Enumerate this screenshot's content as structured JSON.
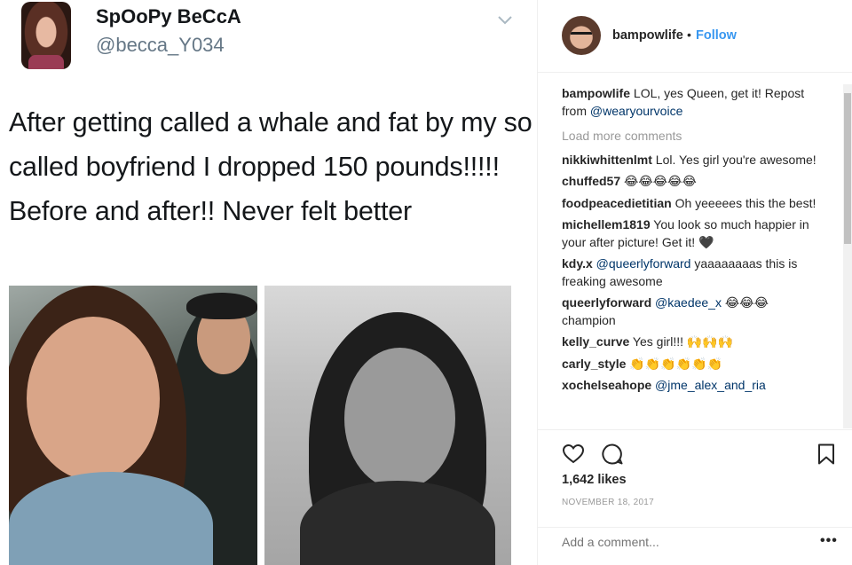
{
  "tweet": {
    "name": "SpOoPy BeCcA",
    "handle": "@becca_Y034",
    "text": "After getting called a whale and fat by my so called boyfriend I dropped 150 pounds!!!!! Before and after!! Never felt better"
  },
  "instagram": {
    "username": "bampowlife",
    "separator": "•",
    "follow_label": "Follow",
    "caption": {
      "user": "bampowlife",
      "text": " LOL, yes Queen, get it! Repost from ",
      "mention": "@wearyourvoice"
    },
    "load_more": "Load more comments",
    "comments": [
      {
        "user": "nikkiwhittenlmt",
        "pre": " Lol. Yes girl you're awesome!",
        "mention": "",
        "post": ""
      },
      {
        "user": "chuffed57",
        "pre": " 😂😂😂😂😂",
        "mention": "",
        "post": ""
      },
      {
        "user": "foodpeacedietitian",
        "pre": " Oh yeeeees this the best!",
        "mention": "",
        "post": ""
      },
      {
        "user": "michellem1819",
        "pre": " You look so much happier in your after picture! Get it! 🖤",
        "mention": "",
        "post": ""
      },
      {
        "user": "kdy.x",
        "pre": " ",
        "mention": "@queerlyforward",
        "post": " yaaaaaaaas this is freaking awesome"
      },
      {
        "user": "queerlyforward",
        "pre": " ",
        "mention": "@kaedee_x",
        "post": " 😂😂😂 champion"
      },
      {
        "user": "kelly_curve",
        "pre": " Yes girl!!! 🙌🙌🙌",
        "mention": "",
        "post": ""
      },
      {
        "user": "carly_style",
        "pre": " 👏👏👏👏👏👏",
        "mention": "",
        "post": ""
      },
      {
        "user": "xochelseahope",
        "pre": " ",
        "mention": "@jme_alex_and_ria",
        "post": ""
      }
    ],
    "likes": "1,642 likes",
    "date": "NOVEMBER 18, 2017",
    "add_comment_placeholder": "Add a comment...",
    "more_label": "•••"
  },
  "colors": {
    "link": "#3897f0",
    "mention": "#003569",
    "muted": "#999999"
  }
}
